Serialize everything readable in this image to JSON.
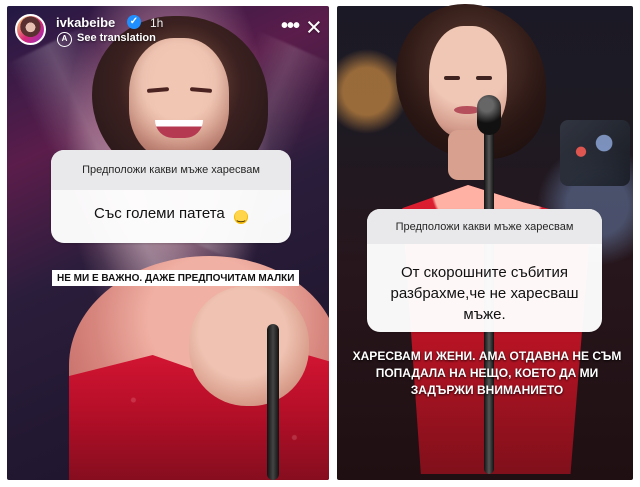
{
  "story_left": {
    "header": {
      "username": "ivkabeibe",
      "time": "1h",
      "see_translation": "See translation"
    },
    "question_card": {
      "question": "Предположи какви мъже харесвам",
      "answer": "Със големи патета"
    },
    "sticker_text": "НЕ МИ Е ВАЖНО. ДАЖЕ ПРЕДПОЧИТАМ МАЛКИ"
  },
  "story_right": {
    "question_card": {
      "question": "Предположи какви мъже харесвам",
      "answer": "От скорошните събития разбрахме,че не харесваш мъже."
    },
    "sticker_text": "ХАРЕСВАМ И ЖЕНИ. АМА ОТДАВНА НЕ СЪМ ПОПАДАЛА НА НЕЩО, КОЕТО ДА МИ ЗАДЪРЖИ ВНИМАНИЕТО"
  },
  "icons": {
    "verified": "verified-badge-icon",
    "translation": "globe-translation-icon",
    "more": "more-options-icon",
    "close": "close-icon",
    "laughing_emoji": "laughing-emoji-icon"
  },
  "colors": {
    "instagram_verified_blue": "#1f8fff",
    "question_header": "#e9e9eb",
    "question_body": "#ffffff",
    "dress_red": "#d81634"
  }
}
